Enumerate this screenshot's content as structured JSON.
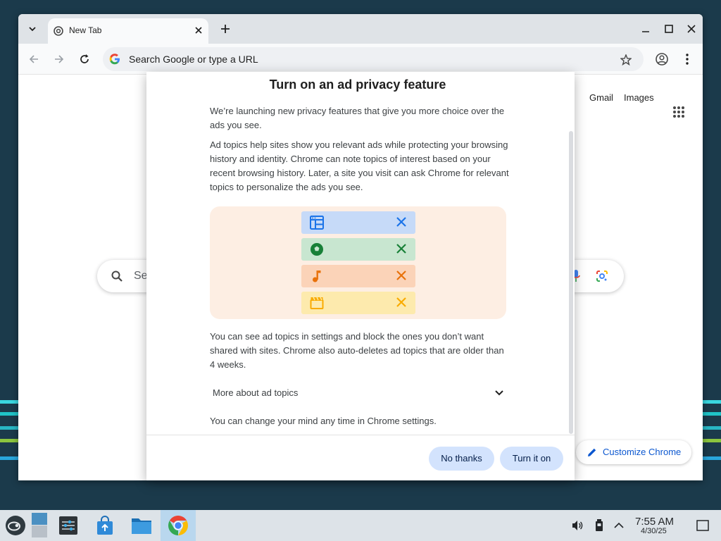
{
  "browser": {
    "tab_title": "New Tab",
    "omnibox_placeholder": "Search Google or type a URL"
  },
  "ntp": {
    "gmail": "Gmail",
    "images": "Images",
    "search_placeholder": "Se",
    "customize": "Customize Chrome"
  },
  "dialog": {
    "title": "Turn on an ad privacy feature",
    "para1": "We’re launching new privacy features that give you more choice over the ads you see.",
    "para2": "Ad topics help sites show you relevant ads while protecting your browsing history and identity. Chrome can note topics of interest based on your recent browsing history. Later, a site you visit can ask Chrome for relevant topics to personalize the ads you see.",
    "para3": "You can see ad topics in settings and block the ones you don’t want shared with sites. Chrome also auto-deletes ad topics that are older than 4 weeks.",
    "expander": "More about ad topics",
    "para4": "You can change your mind any time in Chrome settings.",
    "no_thanks": "No thanks",
    "turn_on": "Turn it on",
    "topics": [
      {
        "icon": "web-layout-icon",
        "color": "#1a73e8",
        "bg": "#c6daf8"
      },
      {
        "icon": "soccer-ball-icon",
        "color": "#188038",
        "bg": "#c8e6d0"
      },
      {
        "icon": "music-note-icon",
        "color": "#e8710a",
        "bg": "#fbd3b8"
      },
      {
        "icon": "clapperboard-icon",
        "color": "#f9ab00",
        "bg": "#fdeaad"
      }
    ]
  },
  "taskbar": {
    "time": "7:55 AM",
    "date": "4/30/25"
  }
}
